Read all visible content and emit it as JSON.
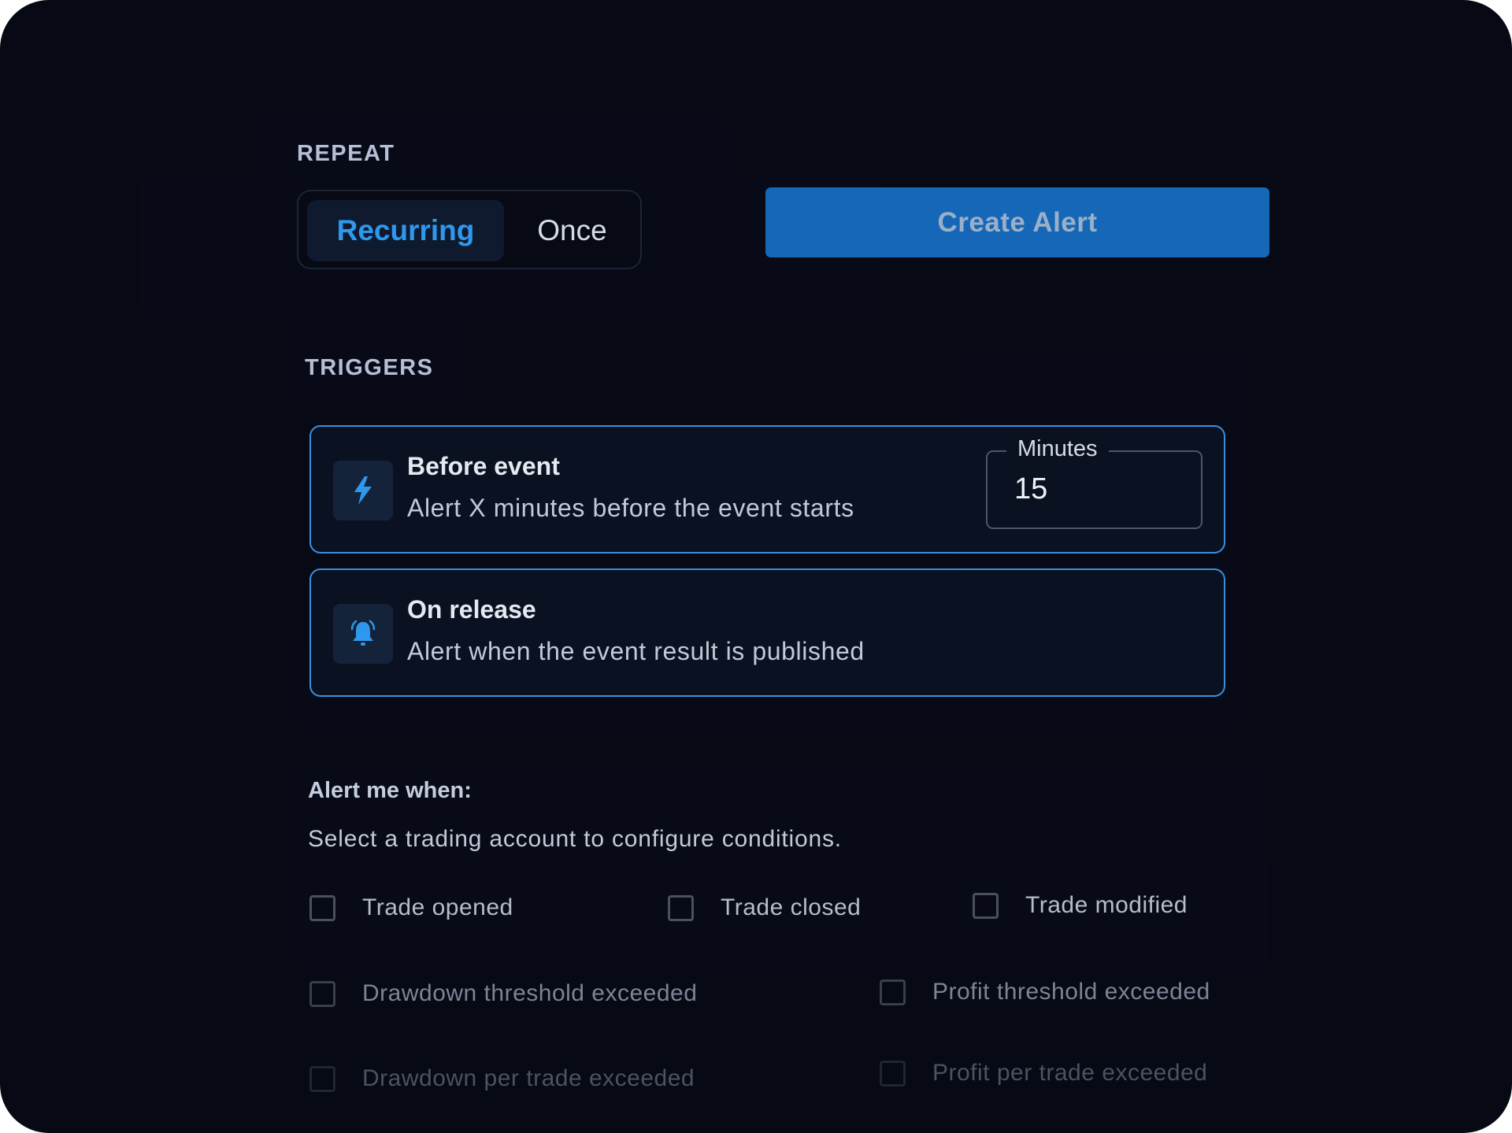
{
  "repeat": {
    "section_label": "REPEAT",
    "options": [
      {
        "label": "Recurring",
        "selected": true
      },
      {
        "label": "Once",
        "selected": false
      }
    ]
  },
  "create_button": {
    "label": "Create Alert"
  },
  "triggers": {
    "section_label": "TRIGGERS",
    "items": [
      {
        "icon": "lightning-bolt-icon",
        "title": "Before event",
        "description": "Alert X minutes before the event starts",
        "minutes_label": "Minutes",
        "minutes_value": "15"
      },
      {
        "icon": "bell-ringing-icon",
        "title": "On release",
        "description": "Alert when the event result is published"
      }
    ]
  },
  "alert_me": {
    "heading": "Alert me when:",
    "subtitle": "Select a trading account to configure conditions.",
    "conditions": [
      {
        "label": "Trade opened",
        "checked": false
      },
      {
        "label": "Trade closed",
        "checked": false
      },
      {
        "label": "Trade modified",
        "checked": false
      },
      {
        "label": "Drawdown threshold exceeded",
        "checked": false
      },
      {
        "label": "Profit threshold exceeded",
        "checked": false
      },
      {
        "label": "Drawdown per trade exceeded",
        "checked": false
      },
      {
        "label": "Profit per trade exceeded",
        "checked": false
      }
    ]
  },
  "colors": {
    "accent": "#2e98ee",
    "primary_button": "#1667b8",
    "background": "#070914",
    "card_border": "#3a8fe0"
  }
}
